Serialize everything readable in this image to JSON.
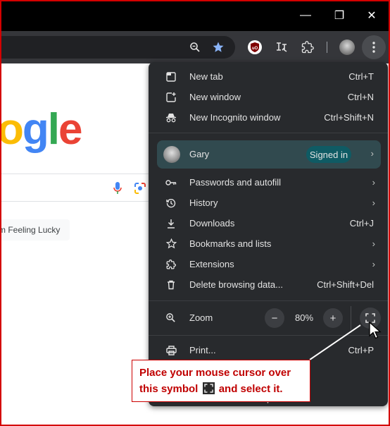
{
  "window": {
    "minimize_glyph": "—",
    "restore_glyph": "❐",
    "close_glyph": "✕"
  },
  "toolbar": {
    "icons": [
      "zoom-icon",
      "bookmark-star-icon",
      "ublock-origin-icon",
      "extension-icon",
      "puzzle-extensions-icon",
      "profile-avatar",
      "kebab-menu-icon"
    ],
    "star_color": "#8ab4f8"
  },
  "page": {
    "logo_text": "ogle",
    "lucky_label": "m Feeling Lucky"
  },
  "menu": {
    "new_tab": {
      "label": "New tab",
      "shortcut": "Ctrl+T"
    },
    "new_window": {
      "label": "New window",
      "shortcut": "Ctrl+N"
    },
    "incognito": {
      "label": "New Incognito window",
      "shortcut": "Ctrl+Shift+N"
    },
    "profile": {
      "name": "Gary",
      "status": "Signed in"
    },
    "passwords": {
      "label": "Passwords and autofill"
    },
    "history": {
      "label": "History"
    },
    "downloads": {
      "label": "Downloads",
      "shortcut": "Ctrl+J"
    },
    "bookmarks": {
      "label": "Bookmarks and lists"
    },
    "extensions": {
      "label": "Extensions"
    },
    "delete_data": {
      "label": "Delete browsing data...",
      "shortcut": "Ctrl+Shift+Del"
    },
    "zoom": {
      "label": "Zoom",
      "minus": "−",
      "value": "80%",
      "plus": "+"
    },
    "print": {
      "label": "Print...",
      "shortcut": "Ctrl+P"
    }
  },
  "callout": {
    "line1": "Place your mouse cursor over",
    "line2_pre": "this symbol",
    "line2_post": "and select it."
  },
  "colors": {
    "menu_bg": "#282a2d",
    "profile_bg": "#314a4f",
    "signed_in_pill": "#0f5b64",
    "callout_text": "#c00000",
    "frame_border": "#d40000"
  }
}
